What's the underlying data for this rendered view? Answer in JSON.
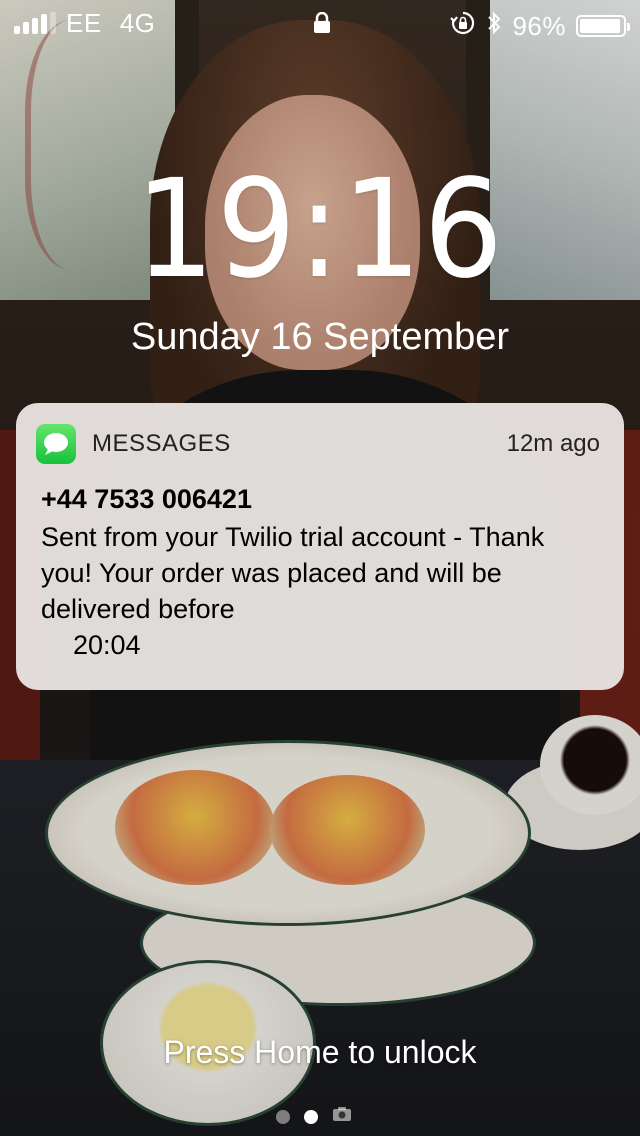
{
  "status_bar": {
    "carrier": "EE",
    "network": "4G",
    "battery_percent": "96%",
    "battery_level": 0.96,
    "signal_bars": 4,
    "icons": [
      "signal-icon",
      "lock-icon",
      "orientation-lock-icon",
      "bluetooth-icon",
      "battery-icon"
    ]
  },
  "lock_screen": {
    "time": "19:16",
    "date": "Sunday 16 September",
    "unlock_hint": "Press Home to unlock",
    "pages": 3,
    "active_page": 2
  },
  "notification": {
    "app_name": "MESSAGES",
    "app_icon": "messages-icon",
    "time_ago": "12m ago",
    "sender": "+44 7533 006421",
    "body": "Sent from your Twilio trial account - Thank you! Your order was placed and will be delivered before",
    "body_time": "20:04"
  },
  "colors": {
    "messages_green": "#1fcf3f",
    "notification_bg": "#ece8e5"
  }
}
